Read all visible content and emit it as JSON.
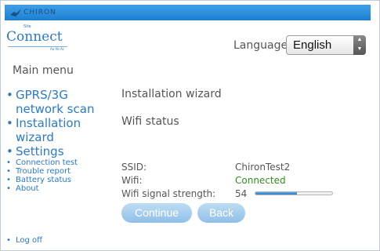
{
  "header": {
    "brand": "CHIRON",
    "product_small": "Site",
    "product": "Connect",
    "product_tagline": "Aa Ab Ac"
  },
  "language": {
    "label": "Language:",
    "selected": "English"
  },
  "menu": {
    "title": "Main menu",
    "items": [
      {
        "label": "GPRS/3G network scan"
      },
      {
        "label": "Installation wizard"
      },
      {
        "label": "Settings"
      },
      {
        "label": "Connection test"
      },
      {
        "label": "Trouble report"
      },
      {
        "label": "Battery status"
      },
      {
        "label": "About"
      }
    ],
    "logoff": "Log off",
    "bullet": "•"
  },
  "main": {
    "title": "Installation wizard",
    "section": "Wifi status",
    "ssid_label": "SSID:",
    "ssid_value": "ChironTest2",
    "wifi_label": "Wifi:",
    "wifi_value": "Connected",
    "signal_label": "Wifi signal strength:",
    "signal_value": "54",
    "signal_fraction": 0.54,
    "continue_label": "Continue",
    "back_label": "Back"
  },
  "colors": {
    "topbar": "#2a8ee0",
    "link": "#2a7ac9",
    "connected": "#2f8f1f",
    "button": "#a8cff0"
  }
}
